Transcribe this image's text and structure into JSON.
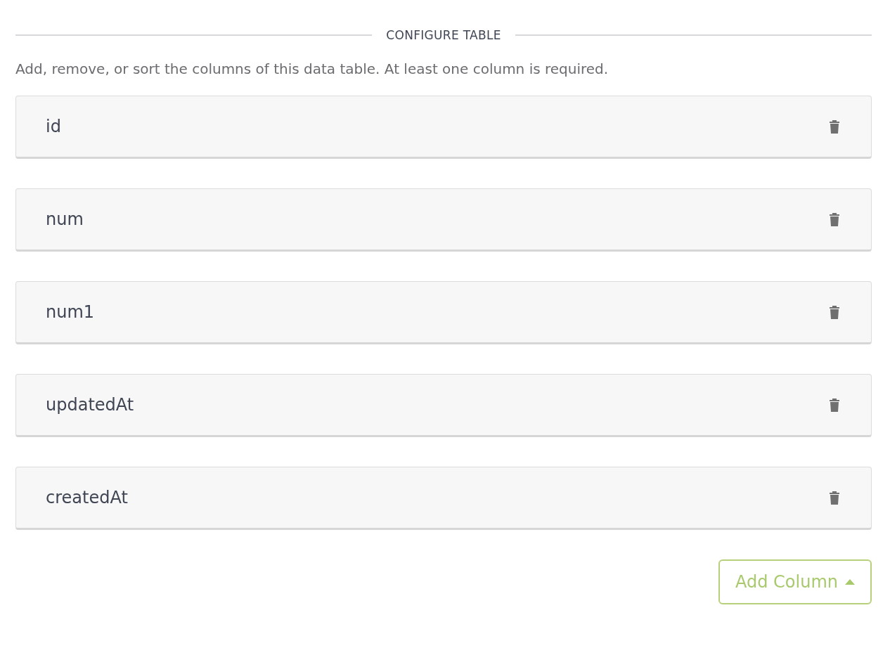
{
  "section_title": "CONFIGURE TABLE",
  "description": "Add, remove, or sort the columns of this data table. At least one column is required.",
  "columns": [
    {
      "name": "id"
    },
    {
      "name": "num"
    },
    {
      "name": "num1"
    },
    {
      "name": "updatedAt"
    },
    {
      "name": "createdAt"
    }
  ],
  "add_button": {
    "label": "Add Column"
  }
}
